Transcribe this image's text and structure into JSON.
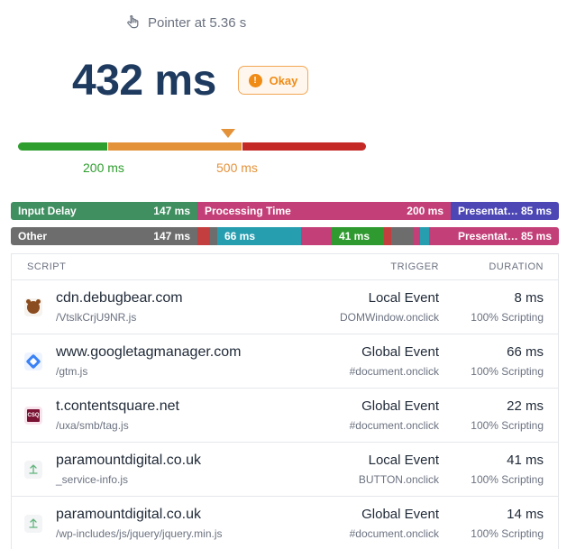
{
  "header": {
    "event_label": "Pointer at 5.36 s",
    "icon": "pointer-icon"
  },
  "metric": {
    "value": "432 ms",
    "rating": "Okay",
    "rating_icon": "!",
    "thresholds": [
      {
        "label": "200 ms",
        "color": "#2e9e2e"
      },
      {
        "label": "500 ms",
        "color": "#e4923a"
      }
    ],
    "bar_colors": {
      "good": "#2e9e2e",
      "needs_improvement": "#e4923a",
      "poor": "#c42926"
    }
  },
  "breakdown": {
    "primary": [
      {
        "label": "Input Delay",
        "value": "147 ms",
        "color": "#3f8f60"
      },
      {
        "label": "Processing Time",
        "value": "200 ms",
        "color": "#c33f78"
      },
      {
        "label": "Presentat…",
        "value": "85 ms",
        "color": "#4d47b5"
      }
    ],
    "secondary": [
      {
        "label": "Other",
        "value": "147 ms",
        "color": "#6d6d6d"
      },
      {
        "label": "",
        "value": "66 ms",
        "color": "#279eb0"
      },
      {
        "label": "",
        "value": "41 ms",
        "color": "#2f9a2f"
      },
      {
        "label": "Presentat…",
        "value": "85 ms",
        "color": "#c33f78"
      }
    ]
  },
  "table": {
    "headers": {
      "script": "SCRIPT",
      "trigger": "TRIGGER",
      "duration": "DURATION"
    },
    "rows": [
      {
        "domain": "cdn.debugbear.com",
        "path": "/VtslkCrjU9NR.js",
        "trigger": "Local Event",
        "trigger_detail": "DOMWindow.onclick",
        "duration": "8 ms",
        "duration_detail": "100% Scripting",
        "icon": "debugbear-icon"
      },
      {
        "domain": "www.googletagmanager.com",
        "path": "/gtm.js",
        "trigger": "Global Event",
        "trigger_detail": "#document.onclick",
        "duration": "66 ms",
        "duration_detail": "100% Scripting",
        "icon": "google-tag-manager-icon"
      },
      {
        "domain": "t.contentsquare.net",
        "path": "/uxa/smb/tag.js",
        "trigger": "Global Event",
        "trigger_detail": "#document.onclick",
        "duration": "22 ms",
        "duration_detail": "100% Scripting",
        "icon": "contentsquare-icon",
        "icon_text": "CSQ"
      },
      {
        "domain": "paramountdigital.co.uk",
        "path": "_service-info.js",
        "trigger": "Local Event",
        "trigger_detail": "BUTTON.onclick",
        "duration": "41 ms",
        "duration_detail": "100% Scripting",
        "icon": "site-icon"
      },
      {
        "domain": "paramountdigital.co.uk",
        "path": "/wp-includes/js/jquery/jquery.min.js",
        "trigger": "Global Event",
        "trigger_detail": "#document.onclick",
        "duration": "14 ms",
        "duration_detail": "100% Scripting",
        "icon": "site-icon"
      }
    ]
  }
}
